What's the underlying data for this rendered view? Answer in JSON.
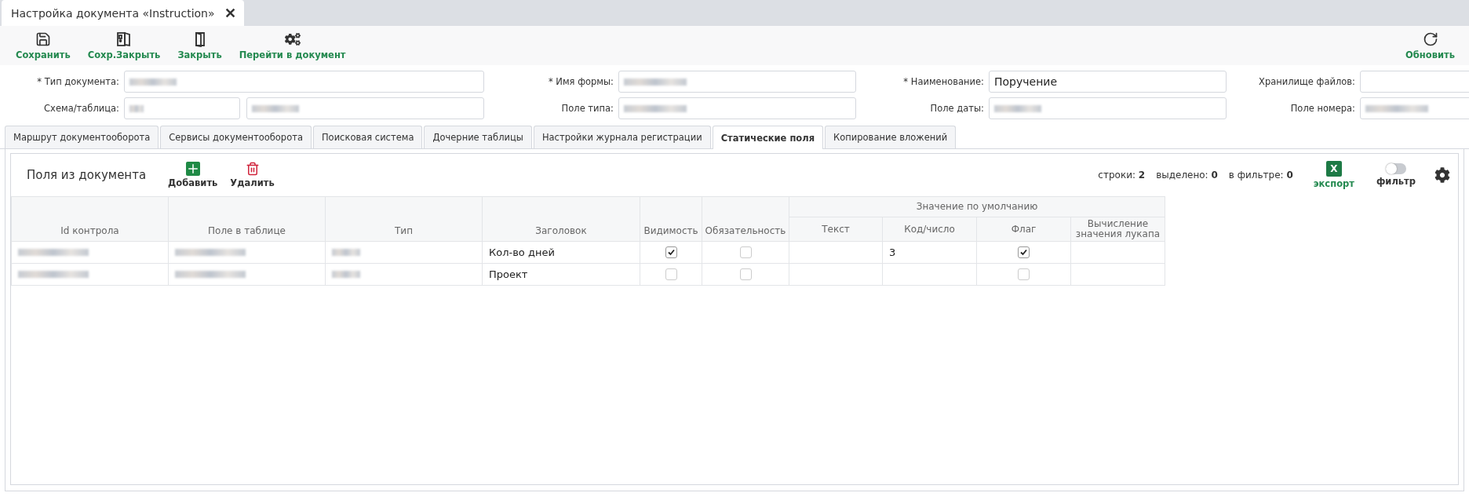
{
  "window": {
    "tab_title": "Настройка документа «Instruction»",
    "close": "✕"
  },
  "toolbar": {
    "left": [
      {
        "kind": "save",
        "label": "Сохранить"
      },
      {
        "kind": "save_close",
        "label": "Сохр.Закрыть"
      },
      {
        "kind": "close",
        "label": "Закрыть"
      },
      {
        "kind": "goto",
        "label": "Перейти в документ"
      }
    ],
    "right": [
      {
        "kind": "refresh",
        "label": "Обновить"
      }
    ]
  },
  "form": {
    "rows": [
      [
        {
          "label": "* Тип документа:",
          "inputs": [
            {
              "redacted": true
            }
          ]
        },
        {
          "label": "* Имя формы:",
          "inputs": [
            {
              "redacted": true
            }
          ]
        },
        {
          "label": "* Наименование:",
          "inputs": [
            {
              "value": "Поручение",
              "redacted": false
            }
          ]
        },
        {
          "label": "Хранилище файлов:",
          "inputs": [
            {
              "redacted": false
            }
          ]
        }
      ],
      [
        {
          "label": "Схема/таблица:",
          "inputs": [
            {
              "redacted": true
            },
            {
              "redacted": true
            }
          ]
        },
        {
          "label": "Поле типа:",
          "inputs": [
            {
              "redacted": true
            }
          ]
        },
        {
          "label": "Поле даты:",
          "inputs": [
            {
              "redacted": true
            }
          ]
        },
        {
          "label": "Поле номера:",
          "inputs": [
            {
              "redacted": true
            }
          ]
        }
      ]
    ]
  },
  "tabs": [
    {
      "label": "Маршрут документооборота",
      "selected": false
    },
    {
      "label": "Сервисы документооборота",
      "selected": false
    },
    {
      "label": "Поисковая система",
      "selected": false
    },
    {
      "label": "Дочерние таблицы",
      "selected": false
    },
    {
      "label": "Настройки журнала регистрации",
      "selected": false
    },
    {
      "label": "Статические поля",
      "selected": true
    },
    {
      "label": "Копирование вложений",
      "selected": false
    }
  ],
  "panel": {
    "title": "Поля из документа",
    "actions": [
      {
        "kind": "add",
        "label": "Добавить"
      },
      {
        "kind": "delete",
        "label": "Удалить"
      }
    ],
    "stats": [
      "строки: **2**",
      "выделено: **0**",
      "в фильтре: **0**"
    ],
    "export": {
      "icon_letter": "X",
      "label": "экспорт"
    },
    "filter": {
      "label": "фильтр",
      "on": false
    }
  },
  "table": {
    "columns": [
      "Id контрола",
      "Поле в таблице",
      "Тип",
      "Заголовок",
      "Видимость",
      "Обязательность"
    ],
    "group_header": "Значение по умолчанию",
    "group_columns": [
      "Текст",
      "Код/число",
      "Флаг",
      "Вычисление значения лукапа"
    ],
    "rows": [
      {
        "id_redacted": true,
        "field_redacted": true,
        "type_redacted": true,
        "caption": "Кол-во дней",
        "visible": true,
        "required": false,
        "text": "",
        "code": "3",
        "flag": true,
        "lookup": ""
      },
      {
        "id_redacted": true,
        "field_redacted": true,
        "type_redacted": true,
        "caption": "Проект",
        "visible": false,
        "required": false,
        "text": "",
        "code": "",
        "flag": false,
        "lookup": ""
      }
    ]
  }
}
